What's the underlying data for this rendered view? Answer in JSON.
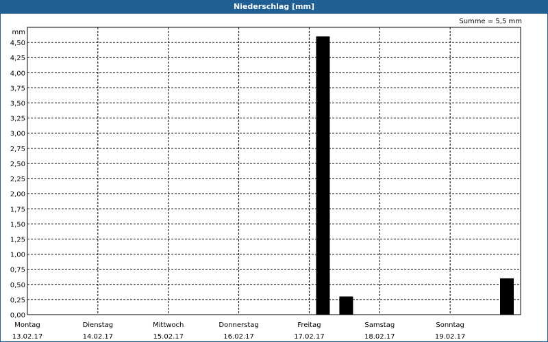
{
  "header": {
    "title": "Niederschlag [mm]",
    "summary": "Summe = 5,5 mm"
  },
  "colors": {
    "title_bar": "#1f5f93",
    "bars": "#000000",
    "grid": "#000000"
  },
  "chart_data": {
    "type": "bar",
    "title": "Niederschlag [mm]",
    "ylabel": "mm",
    "xlabel": "",
    "ylim": [
      0,
      4.75
    ],
    "grid": true,
    "y_ticks": [
      {
        "value": 0,
        "label": "0,00"
      },
      {
        "value": 0.25,
        "label": "0,25"
      },
      {
        "value": 0.5,
        "label": "0,50"
      },
      {
        "value": 0.75,
        "label": "0,75"
      },
      {
        "value": 1.0,
        "label": "1,00"
      },
      {
        "value": 1.25,
        "label": "1,25"
      },
      {
        "value": 1.5,
        "label": "1,50"
      },
      {
        "value": 1.75,
        "label": "1,75"
      },
      {
        "value": 2.0,
        "label": "2,00"
      },
      {
        "value": 2.25,
        "label": "2,25"
      },
      {
        "value": 2.5,
        "label": "2,50"
      },
      {
        "value": 2.75,
        "label": "2,75"
      },
      {
        "value": 3.0,
        "label": "3,00"
      },
      {
        "value": 3.25,
        "label": "3,25"
      },
      {
        "value": 3.5,
        "label": "3,50"
      },
      {
        "value": 3.75,
        "label": "3,75"
      },
      {
        "value": 4.0,
        "label": "4,00"
      },
      {
        "value": 4.25,
        "label": "4,25"
      },
      {
        "value": 4.5,
        "label": "4,50"
      }
    ],
    "days": [
      {
        "name": "Montag",
        "date": "13.02.17"
      },
      {
        "name": "Dienstag",
        "date": "14.02.17"
      },
      {
        "name": "Mittwoch",
        "date": "15.02.17"
      },
      {
        "name": "Donnerstag",
        "date": "16.02.17"
      },
      {
        "name": "Freitag",
        "date": "17.02.17"
      },
      {
        "name": "Samstag",
        "date": "18.02.17"
      },
      {
        "name": "Sonntag",
        "date": "19.02.17"
      }
    ],
    "bars": [
      {
        "day": "Freitag",
        "slot": "00-12",
        "value": 4.6
      },
      {
        "day": "Freitag",
        "slot": "12-24",
        "value": 0.3
      },
      {
        "day": "Sonntag",
        "slot": "12-24",
        "value": 0.6
      }
    ]
  }
}
